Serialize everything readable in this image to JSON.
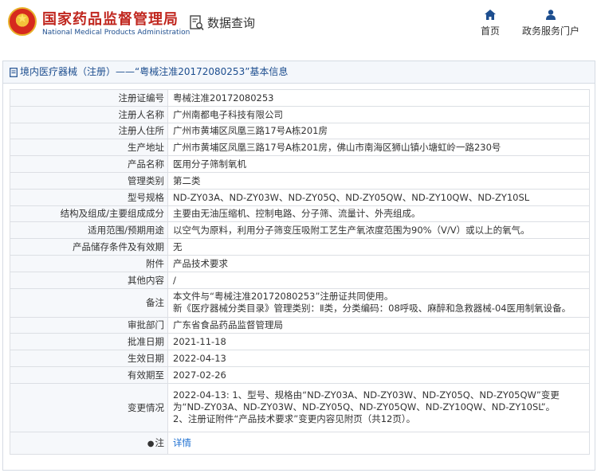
{
  "header": {
    "site_title_cn": "国家药品监督管理局",
    "site_title_en": "National Medical Products Administration",
    "db_query_label": "数据查询",
    "nav": [
      {
        "label": "首页",
        "icon": "home-icon"
      },
      {
        "label": "政务服务门户",
        "icon": "user-icon"
      }
    ]
  },
  "breadcrumb": {
    "text": "境内医疗器械（注册）——“粤械注准20172080253”基本信息"
  },
  "detail": {
    "rows": [
      {
        "key": "注册证编号",
        "value": "粤械注准20172080253"
      },
      {
        "key": "注册人名称",
        "value": "广州南都电子科技有限公司"
      },
      {
        "key": "注册人住所",
        "value": "广州市黄埔区凤凰三路17号A栋201房"
      },
      {
        "key": "生产地址",
        "value": "广州市黄埔区凤凰三路17号A栋201房，佛山市南海区狮山镇小塘虹岭一路230号"
      },
      {
        "key": "产品名称",
        "value": "医用分子筛制氧机"
      },
      {
        "key": "管理类别",
        "value": "第二类"
      },
      {
        "key": "型号规格",
        "value": "ND-ZY03A、ND-ZY03W、ND-ZY05Q、ND-ZY05QW、ND-ZY10QW、ND-ZY10SL"
      },
      {
        "key": "结构及组成/主要组成成分",
        "value": "主要由无油压缩机、控制电路、分子筛、流量计、外壳组成。"
      },
      {
        "key": "适用范围/预期用途",
        "value": "以空气为原料，利用分子筛变压吸附工艺生产氧浓度范围为90%（V/V）或以上的氧气。"
      },
      {
        "key": "产品储存条件及有效期",
        "value": "无"
      },
      {
        "key": "附件",
        "value": "产品技术要求"
      },
      {
        "key": "其他内容",
        "value": "/"
      },
      {
        "key": "备注",
        "value": "本文件与“粤械注准20172080253”注册证共同使用。\n新《医疗器械分类目录》管理类别：Ⅱ类，分类编码：08呼吸、麻醉和急救器械-04医用制氧设备。"
      },
      {
        "key": "审批部门",
        "value": "广东省食品药品监督管理局"
      },
      {
        "key": "批准日期",
        "value": "2021-11-18"
      },
      {
        "key": "生效日期",
        "value": "2022-04-13"
      },
      {
        "key": "有效期至",
        "value": "2027-02-26"
      },
      {
        "key": "变更情况",
        "value": "2022-04-13: 1、型号、规格由“ND-ZY03A、ND-ZY03W、ND-ZY05Q、ND-ZY05QW”变更为“ND-ZY03A、ND-ZY03W、ND-ZY05Q、ND-ZY05QW、ND-ZY10QW、ND-ZY10SL”。\n2、注册证附件“产品技术要求”变更内容见附页（共12页）。"
      }
    ],
    "note_key": "注",
    "note_link": "详情"
  }
}
